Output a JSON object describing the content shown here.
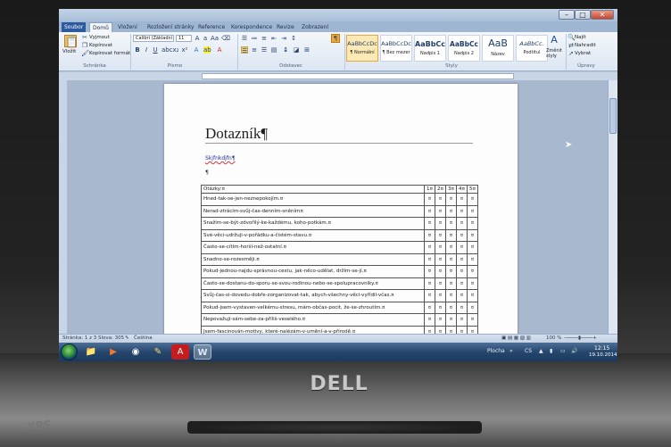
{
  "device": {
    "brand": "DELL",
    "side_logo": "XPS"
  },
  "window": {
    "minimize": "–",
    "maximize": "□",
    "close": "✕"
  },
  "ribbon_tabs": [
    "Soubor",
    "Domů",
    "Vložení",
    "Rozložení stránky",
    "Reference",
    "Korespondence",
    "Revize",
    "Zobrazení"
  ],
  "ribbon": {
    "clipboard": {
      "paste_label": "Vložit",
      "cut_label": "Vyjmout",
      "copy_label": "Kopírovat",
      "format_painter_label": "Kopírovat formát",
      "group_label": "Schránka"
    },
    "font": {
      "font_name": "Calibri (Základní",
      "font_size": "11",
      "group_label": "Písmo"
    },
    "paragraph": {
      "group_label": "Odstavec"
    },
    "styles": {
      "items": [
        {
          "sample": "AaBbCcDc",
          "name": "¶ Normální"
        },
        {
          "sample": "AaBbCcDc",
          "name": "¶ Bez mezer"
        },
        {
          "sample": "AaBbCc",
          "name": "Nadpis 1"
        },
        {
          "sample": "AaBbCc",
          "name": "Nadpis 2"
        },
        {
          "sample": "AaB",
          "name": "Název"
        },
        {
          "sample": "AaBbCc.",
          "name": "Podtitul"
        }
      ],
      "change_styles_label": "Změnit styly",
      "group_label": "Styly"
    },
    "editing": {
      "find_label": "Najít",
      "replace_label": "Nahradit",
      "select_label": "Vybrat",
      "group_label": "Úpravy"
    }
  },
  "document": {
    "title": "Dotazník¶",
    "link_text": "Skjfnkdjfn¶",
    "empty_paragraph": "¶",
    "table": {
      "header_question": "Otázky:¤",
      "header_scores": [
        "1¤",
        "2¤",
        "3¤",
        "4¤",
        "5¤"
      ],
      "cell_marker": "¤",
      "rows": [
        "Hned-tak-se-jen-neznepokojím.¤",
        "Nerad-ztrácím-svůj-čas-denním-sněním¤",
        "Snažím-se-být-zdvořilý-ke-každému, koho-potkám.¤",
        "Své-věci-udržuji-v-pořádku-a-čistém-stavu.¤",
        "Často-se-cítím-horší-než-ostatní.¤",
        "Snadno-se-rozesměji.¤",
        "Pokud-jednou-najdu-správnou-cestu, jak-něco-udělat, držím-se-jí.¤",
        "Často-se-dostanu-do-sporu-se-svou-rodinou-nebo-se-spolupracovníky.¤",
        "Svůj-čas-si-dovedu-dobře-zorganizovat-tak, abych-všechny-věci-vyřídil-včas.¤",
        "Pokud-jsem-vystaven-velkému-stresu, mám-občas-pocit, že-se-zhroutím.¤",
        "Nepovažuji-sám-sebe-za-příliš-veselého.¤",
        "Jsem-fascinován-motivy, které-nalézám-v-umění-a-v-přírodě.¤"
      ]
    }
  },
  "statusbar": {
    "page": "Stránka: 1 z 3",
    "words": "Slova: 305",
    "language": "Čeština",
    "zoom": "100 %"
  },
  "taskbar": {
    "keyboard_layout": "CS",
    "desktop_label": "Plocha",
    "time": "12:15",
    "date": "19.10.2014"
  }
}
